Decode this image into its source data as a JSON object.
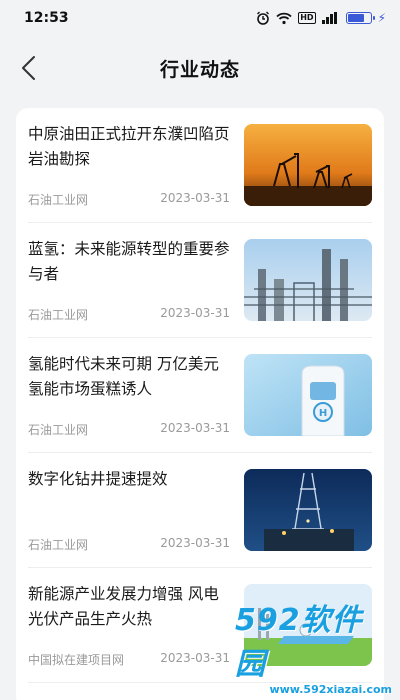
{
  "status_bar": {
    "time": "12:53",
    "hd": "HD",
    "battery_level": 0.75
  },
  "header": {
    "title": "行业动态",
    "back_icon": "chevron-left-icon"
  },
  "news": [
    {
      "title": "中原油田正式拉开东濮凹陷页岩油勘探",
      "source": "石油工业网",
      "date": "2023-03-31",
      "thumb": "oil-pumps-sunset"
    },
    {
      "title": "蓝氢：未来能源转型的重要参与者",
      "source": "石油工业网",
      "date": "2023-03-31",
      "thumb": "refinery-towers"
    },
    {
      "title": "氢能时代未来可期 万亿美元氢能市场蛋糕诱人",
      "source": "石油工业网",
      "date": "2023-03-31",
      "thumb": "hydrogen-station"
    },
    {
      "title": "数字化钻井提速提效",
      "source": "石油工业网",
      "date": "2023-03-31",
      "thumb": "drilling-rig-night"
    },
    {
      "title": "新能源产业发展力增强 风电光伏产品生产火热",
      "source": "中国拟在建项目网",
      "date": "2023-03-31",
      "thumb": "new-energy-plant"
    }
  ],
  "watermark": {
    "logo_num": "592",
    "logo_text": "软件园",
    "url": "www.592xiazai.com"
  },
  "colors": {
    "accent": "#3a5ad8",
    "watermark": "#1aa0e0"
  }
}
